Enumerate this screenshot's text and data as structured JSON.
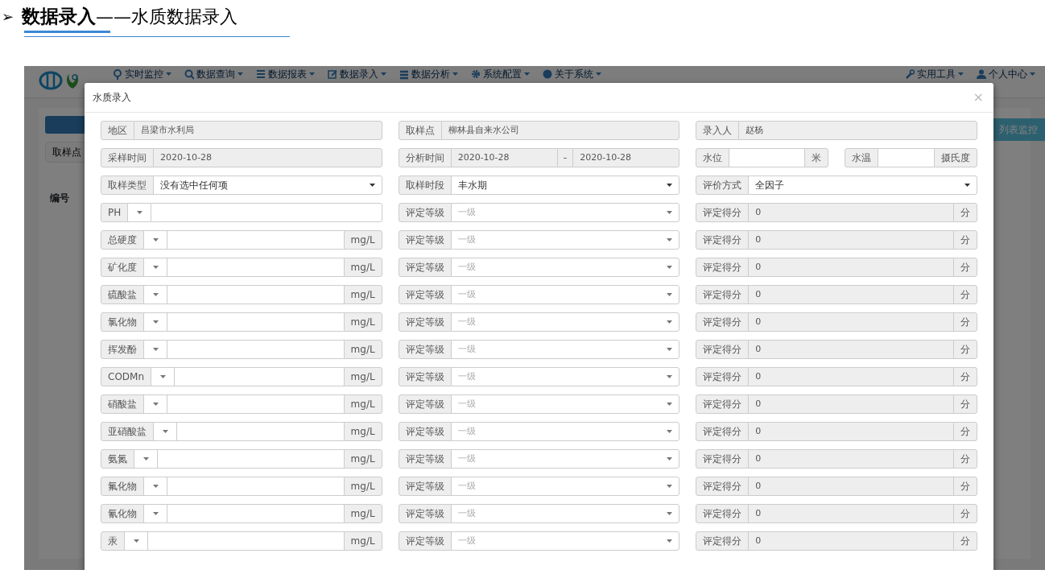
{
  "heading": {
    "arrow": "➢",
    "title": "数据录入",
    "subtitle": "——水质数据录入"
  },
  "app": {
    "nav": [
      {
        "label": "实时监控"
      },
      {
        "label": "数据查询"
      },
      {
        "label": "数据报表"
      },
      {
        "label": "数据录入"
      },
      {
        "label": "数据分析"
      },
      {
        "label": "系统配置"
      },
      {
        "label": "关于系统"
      }
    ],
    "nav_right": [
      {
        "label": "实用工具"
      },
      {
        "label": "个人中心"
      }
    ],
    "filter_button": "取样点",
    "table_header": "编号",
    "monitor_button": "列表监控"
  },
  "modal": {
    "title": "水质录入",
    "close": "×",
    "rows": [
      [
        {
          "kind": "readonly",
          "label": "地区",
          "value": "昌梁市水利局"
        },
        {
          "kind": "readonly",
          "label": "取样点",
          "value": "柳林县自来水公司"
        },
        {
          "kind": "readonly",
          "label": "录入人",
          "value": "赵杨"
        }
      ],
      [
        {
          "kind": "readonly",
          "label": "采样时间",
          "value": "2020-10-28"
        },
        {
          "kind": "range",
          "label": "分析时间",
          "from": "2020-10-28",
          "separator": "-",
          "to": "2020-10-28"
        },
        {
          "kind": "pair",
          "parts": [
            {
              "label": "水位",
              "unit": "米"
            },
            {
              "label": "水温",
              "unit": "摄氏度"
            }
          ]
        }
      ],
      [
        {
          "kind": "select",
          "label": "取样类型",
          "value": "没有选中任何项"
        },
        {
          "kind": "select",
          "label": "取样时段",
          "value": "丰水期"
        },
        {
          "kind": "select",
          "label": "评价方式",
          "value": "全因子"
        }
      ]
    ],
    "factors": [
      {
        "name": "PH",
        "grade_label": "评定等级",
        "grade": "一级",
        "score_label": "评定得分",
        "score": "0",
        "score_unit": "分"
      },
      {
        "name": "总硬度",
        "unit": "mg/L",
        "grade_label": "评定等级",
        "grade": "一级",
        "score_label": "评定得分",
        "score": "0",
        "score_unit": "分"
      },
      {
        "name": "矿化度",
        "unit": "mg/L",
        "grade_label": "评定等级",
        "grade": "一级",
        "score_label": "评定得分",
        "score": "0",
        "score_unit": "分"
      },
      {
        "name": "硫酸盐",
        "unit": "mg/L",
        "grade_label": "评定等级",
        "grade": "一级",
        "score_label": "评定得分",
        "score": "0",
        "score_unit": "分"
      },
      {
        "name": "氯化物",
        "unit": "mg/L",
        "grade_label": "评定等级",
        "grade": "一级",
        "score_label": "评定得分",
        "score": "0",
        "score_unit": "分"
      },
      {
        "name": "挥发酚",
        "unit": "mg/L",
        "grade_label": "评定等级",
        "grade": "一级",
        "score_label": "评定得分",
        "score": "0",
        "score_unit": "分"
      },
      {
        "name": "CODMn",
        "unit": "mg/L",
        "grade_label": "评定等级",
        "grade": "一级",
        "score_label": "评定得分",
        "score": "0",
        "score_unit": "分"
      },
      {
        "name": "硝酸盐",
        "unit": "mg/L",
        "grade_label": "评定等级",
        "grade": "一级",
        "score_label": "评定得分",
        "score": "0",
        "score_unit": "分"
      },
      {
        "name": "亚硝酸盐",
        "unit": "mg/L",
        "grade_label": "评定等级",
        "grade": "一级",
        "score_label": "评定得分",
        "score": "0",
        "score_unit": "分"
      },
      {
        "name": "氨氮",
        "unit": "mg/L",
        "grade_label": "评定等级",
        "grade": "一级",
        "score_label": "评定得分",
        "score": "0",
        "score_unit": "分"
      },
      {
        "name": "氟化物",
        "unit": "mg/L",
        "grade_label": "评定等级",
        "grade": "一级",
        "score_label": "评定得分",
        "score": "0",
        "score_unit": "分"
      },
      {
        "name": "氰化物",
        "unit": "mg/L",
        "grade_label": "评定等级",
        "grade": "一级",
        "score_label": "评定得分",
        "score": "0",
        "score_unit": "分"
      },
      {
        "name": "汞",
        "unit": "mg/L",
        "grade_label": "评定等级",
        "grade": "一级",
        "score_label": "评定得分",
        "score": "0",
        "score_unit": "分"
      }
    ]
  }
}
